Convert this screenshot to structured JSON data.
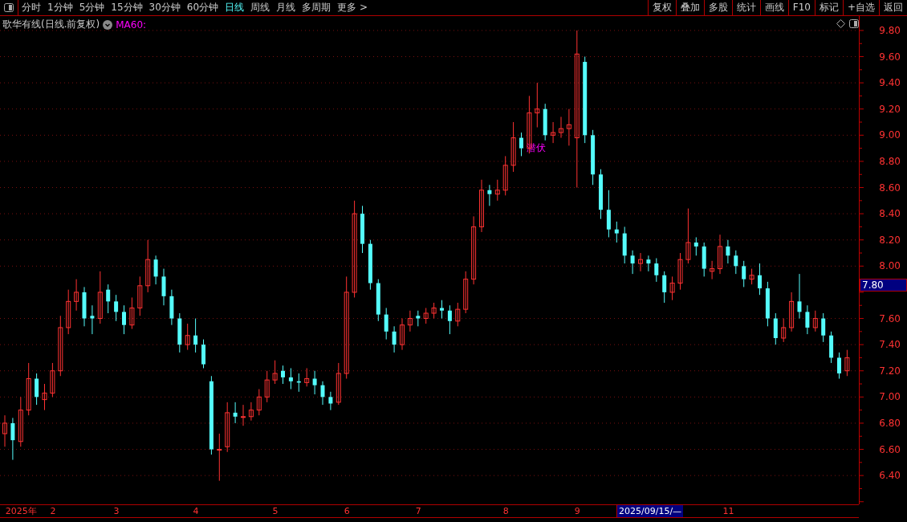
{
  "toolbar": {
    "tabs": [
      {
        "label": "分时",
        "selected": false
      },
      {
        "label": "1分钟",
        "selected": false
      },
      {
        "label": "5分钟",
        "selected": false
      },
      {
        "label": "15分钟",
        "selected": false
      },
      {
        "label": "30分钟",
        "selected": false
      },
      {
        "label": "60分钟",
        "selected": false
      },
      {
        "label": "日线",
        "selected": true
      },
      {
        "label": "周线",
        "selected": false
      },
      {
        "label": "月线",
        "selected": false
      },
      {
        "label": "多周期",
        "selected": false
      },
      {
        "label": "更多 >",
        "selected": false
      }
    ],
    "buttons": [
      "复权",
      "叠加",
      "多股",
      "统计",
      "画线",
      "F10",
      "标记",
      "+自选",
      "返回"
    ]
  },
  "legend": {
    "title": "歌华有线(日线.前复权)",
    "indicator": "MA60:"
  },
  "chart": {
    "chart_data": {
      "type": "candlestick",
      "ylim": [
        6.18,
        9.91
      ],
      "yticks": [
        {
          "value": 9.8,
          "label": "9.80"
        },
        {
          "value": 9.6,
          "label": "9.60"
        },
        {
          "value": 9.4,
          "label": "9.40"
        },
        {
          "value": 9.2,
          "label": "9.20"
        },
        {
          "value": 9.0,
          "label": "9.00"
        },
        {
          "value": 8.8,
          "label": "8.80"
        },
        {
          "value": 8.6,
          "label": "8.60"
        },
        {
          "value": 8.4,
          "label": "8.40"
        },
        {
          "value": 8.2,
          "label": "8.20"
        },
        {
          "value": 8.0,
          "label": "8.00"
        },
        {
          "value": 7.6,
          "label": "7.60"
        },
        {
          "value": 7.4,
          "label": "7.40"
        },
        {
          "value": 7.2,
          "label": "7.20"
        },
        {
          "value": 7.0,
          "label": "7.00"
        },
        {
          "value": 6.8,
          "label": "6.80"
        },
        {
          "value": 6.6,
          "label": "6.60"
        },
        {
          "value": 6.4,
          "label": "6.40"
        }
      ],
      "ohlc": [
        [
          6.72,
          6.86,
          6.62,
          6.8
        ],
        [
          6.8,
          6.84,
          6.52,
          6.67
        ],
        [
          6.66,
          7.0,
          6.62,
          6.9
        ],
        [
          6.9,
          7.26,
          6.86,
          7.14
        ],
        [
          7.14,
          7.18,
          6.94,
          7.0
        ],
        [
          6.98,
          7.1,
          6.9,
          7.03
        ],
        [
          7.03,
          7.26,
          7.0,
          7.2
        ],
        [
          7.2,
          7.62,
          7.16,
          7.53
        ],
        [
          7.53,
          7.82,
          7.48,
          7.73
        ],
        [
          7.73,
          7.9,
          7.66,
          7.8
        ],
        [
          7.8,
          7.84,
          7.54,
          7.6
        ],
        [
          7.62,
          7.7,
          7.48,
          7.6
        ],
        [
          7.6,
          7.96,
          7.56,
          7.8
        ],
        [
          7.82,
          7.86,
          7.64,
          7.73
        ],
        [
          7.73,
          7.78,
          7.58,
          7.65
        ],
        [
          7.65,
          7.7,
          7.48,
          7.55
        ],
        [
          7.55,
          7.76,
          7.52,
          7.68
        ],
        [
          7.68,
          7.92,
          7.62,
          7.85
        ],
        [
          7.85,
          8.2,
          7.8,
          8.05
        ],
        [
          8.05,
          8.08,
          7.86,
          7.92
        ],
        [
          7.92,
          7.98,
          7.7,
          7.77
        ],
        [
          7.77,
          7.82,
          7.55,
          7.6
        ],
        [
          7.6,
          7.64,
          7.34,
          7.4
        ],
        [
          7.4,
          7.56,
          7.36,
          7.47
        ],
        [
          7.47,
          7.6,
          7.34,
          7.4
        ],
        [
          7.4,
          7.44,
          7.22,
          7.25
        ],
        [
          7.12,
          7.16,
          6.56,
          6.6
        ],
        [
          6.6,
          6.72,
          6.36,
          6.6
        ],
        [
          6.62,
          6.96,
          6.58,
          6.88
        ],
        [
          6.88,
          6.96,
          6.8,
          6.85
        ],
        [
          6.85,
          6.94,
          6.78,
          6.85
        ],
        [
          6.85,
          6.96,
          6.82,
          6.9
        ],
        [
          6.9,
          7.06,
          6.86,
          7.0
        ],
        [
          7.0,
          7.2,
          6.96,
          7.13
        ],
        [
          7.13,
          7.28,
          7.1,
          7.18
        ],
        [
          7.2,
          7.24,
          7.1,
          7.15
        ],
        [
          7.15,
          7.22,
          7.06,
          7.12
        ],
        [
          7.12,
          7.18,
          7.04,
          7.11
        ],
        [
          7.11,
          7.22,
          7.08,
          7.14
        ],
        [
          7.14,
          7.2,
          7.02,
          7.09
        ],
        [
          7.09,
          7.12,
          6.94,
          7.0
        ],
        [
          7.0,
          7.04,
          6.9,
          6.95
        ],
        [
          6.96,
          7.26,
          6.94,
          7.18
        ],
        [
          7.18,
          7.92,
          7.14,
          7.8
        ],
        [
          7.8,
          8.5,
          7.76,
          8.4
        ],
        [
          8.4,
          8.46,
          8.1,
          8.17
        ],
        [
          8.17,
          8.2,
          7.82,
          7.87
        ],
        [
          7.87,
          7.9,
          7.58,
          7.63
        ],
        [
          7.63,
          7.68,
          7.44,
          7.5
        ],
        [
          7.5,
          7.54,
          7.34,
          7.4
        ],
        [
          7.4,
          7.6,
          7.36,
          7.55
        ],
        [
          7.55,
          7.66,
          7.5,
          7.6
        ],
        [
          7.62,
          7.66,
          7.54,
          7.6
        ],
        [
          7.6,
          7.68,
          7.56,
          7.64
        ],
        [
          7.64,
          7.72,
          7.6,
          7.68
        ],
        [
          7.68,
          7.74,
          7.6,
          7.66
        ],
        [
          7.66,
          7.7,
          7.48,
          7.58
        ],
        [
          7.58,
          7.72,
          7.54,
          7.67
        ],
        [
          7.67,
          7.96,
          7.64,
          7.9
        ],
        [
          7.9,
          8.38,
          7.86,
          8.3
        ],
        [
          8.3,
          8.66,
          8.26,
          8.58
        ],
        [
          8.58,
          8.62,
          8.46,
          8.55
        ],
        [
          8.55,
          8.66,
          8.5,
          8.58
        ],
        [
          8.58,
          8.84,
          8.54,
          8.77
        ],
        [
          8.77,
          9.1,
          8.72,
          8.98
        ],
        [
          8.98,
          9.02,
          8.84,
          8.9
        ],
        [
          8.9,
          9.3,
          8.86,
          9.17
        ],
        [
          9.17,
          9.4,
          9.06,
          9.2
        ],
        [
          9.2,
          9.24,
          8.96,
          9.0
        ],
        [
          9.0,
          9.1,
          8.94,
          9.02
        ],
        [
          9.02,
          9.14,
          8.98,
          9.05
        ],
        [
          9.05,
          9.2,
          8.92,
          9.08
        ],
        [
          8.98,
          9.8,
          8.6,
          9.62
        ],
        [
          9.56,
          9.6,
          8.94,
          9.0
        ],
        [
          9.0,
          9.04,
          8.62,
          8.7
        ],
        [
          8.7,
          8.74,
          8.36,
          8.43
        ],
        [
          8.43,
          8.58,
          8.22,
          8.28
        ],
        [
          8.28,
          8.34,
          8.18,
          8.25
        ],
        [
          8.25,
          8.3,
          8.02,
          8.08
        ],
        [
          8.08,
          8.12,
          7.94,
          8.02
        ],
        [
          8.02,
          8.1,
          7.96,
          8.05
        ],
        [
          8.05,
          8.08,
          7.96,
          8.02
        ],
        [
          8.02,
          8.06,
          7.88,
          7.93
        ],
        [
          7.93,
          7.96,
          7.72,
          7.8
        ],
        [
          7.8,
          7.92,
          7.74,
          7.87
        ],
        [
          7.87,
          8.1,
          7.82,
          8.05
        ],
        [
          8.05,
          8.44,
          8.02,
          8.18
        ],
        [
          8.18,
          8.22,
          8.08,
          8.15
        ],
        [
          8.15,
          8.18,
          7.92,
          7.98
        ],
        [
          7.96,
          8.04,
          7.9,
          7.98
        ],
        [
          7.98,
          8.24,
          7.94,
          8.15
        ],
        [
          8.15,
          8.2,
          8.02,
          8.08
        ],
        [
          8.08,
          8.12,
          7.94,
          8.0
        ],
        [
          8.0,
          8.04,
          7.84,
          7.9
        ],
        [
          7.9,
          7.98,
          7.86,
          7.93
        ],
        [
          7.93,
          8.02,
          7.78,
          7.83
        ],
        [
          7.83,
          7.88,
          7.54,
          7.6
        ],
        [
          7.6,
          7.64,
          7.4,
          7.45
        ],
        [
          7.45,
          7.6,
          7.42,
          7.53
        ],
        [
          7.53,
          7.8,
          7.5,
          7.73
        ],
        [
          7.73,
          7.94,
          7.6,
          7.65
        ],
        [
          7.65,
          7.7,
          7.48,
          7.53
        ],
        [
          7.53,
          7.66,
          7.5,
          7.6
        ],
        [
          7.6,
          7.64,
          7.42,
          7.47
        ],
        [
          7.47,
          7.5,
          7.26,
          7.3
        ],
        [
          7.3,
          7.34,
          7.14,
          7.18
        ],
        [
          7.2,
          7.36,
          7.16,
          7.3
        ]
      ],
      "categories": [
        null,
        null,
        "2025年",
        null,
        null,
        null,
        "2",
        null,
        null,
        null,
        null,
        null,
        null,
        null,
        "3",
        null,
        null,
        null,
        null,
        null,
        null,
        null,
        null,
        null,
        "4",
        null,
        null,
        null,
        null,
        null,
        null,
        null,
        null,
        null,
        "5",
        null,
        null,
        null,
        null,
        null,
        null,
        null,
        null,
        "6",
        null,
        null,
        null,
        null,
        null,
        null,
        null,
        null,
        "7",
        null,
        null,
        null,
        null,
        null,
        null,
        null,
        null,
        null,
        null,
        "8",
        null,
        null,
        null,
        null,
        null,
        null,
        null,
        null,
        "9",
        null,
        null,
        null,
        null,
        null,
        null,
        null,
        null,
        null,
        null,
        null,
        null,
        null,
        null,
        null,
        null,
        null,
        null,
        "11",
        null,
        null,
        null,
        null,
        null,
        null,
        null,
        null,
        null,
        null,
        null,
        null,
        null,
        null,
        null
      ],
      "grid": true,
      "annotations": [
        {
          "text": "潜伏"
        }
      ]
    }
  },
  "price_axis": {
    "cursor_price": "7.80"
  },
  "time_axis": {
    "cursor_date": "2025/09/15/—"
  }
}
